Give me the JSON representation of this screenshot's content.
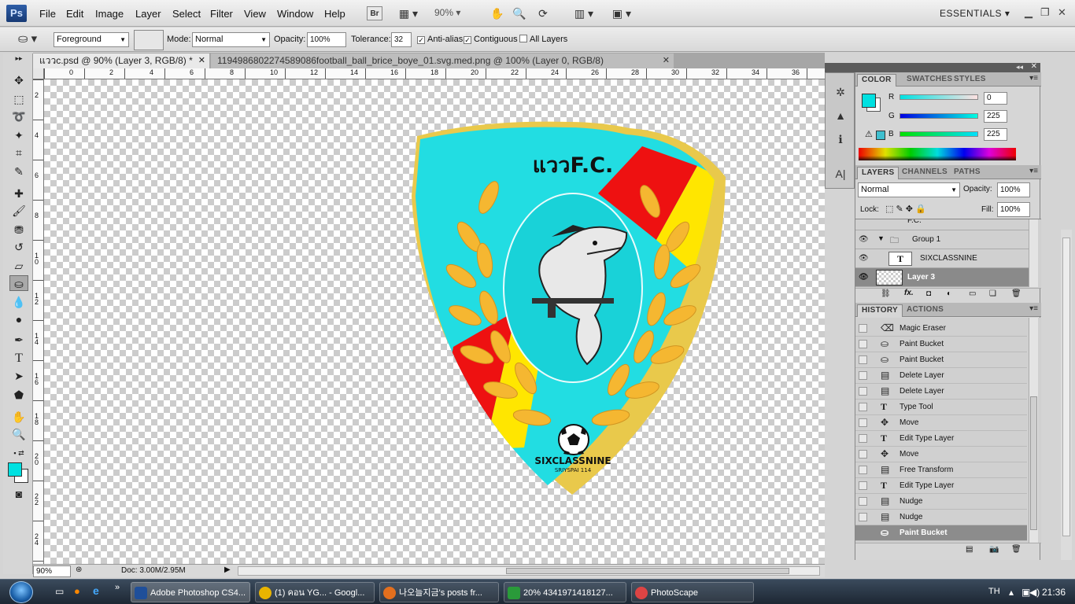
{
  "menubar": {
    "logo": "Ps",
    "items": [
      "File",
      "Edit",
      "Image",
      "Layer",
      "Select",
      "Filter",
      "View",
      "Window",
      "Help"
    ],
    "br_label": "Br",
    "zoom": "90%",
    "workspace": "ESSENTIALS"
  },
  "options": {
    "fill_source": "Foreground",
    "mode_label": "Mode:",
    "mode_value": "Normal",
    "opacity_label": "Opacity:",
    "opacity_value": "100%",
    "tolerance_label": "Tolerance:",
    "tolerance_value": "32",
    "anti_alias": "Anti-alias",
    "contiguous": "Contiguous",
    "all_layers": "All Layers"
  },
  "tabs": [
    {
      "label": "แววc.psd @ 90% (Layer 3, RGB/8) *"
    },
    {
      "label": "1194986802274589086football_ball_brice_boye_01.svg.med.png @ 100% (Layer 0, RGB/8)"
    }
  ],
  "ruler": {
    "top": [
      "0",
      "2",
      "4",
      "6",
      "8",
      "10",
      "12",
      "14",
      "16",
      "18",
      "20",
      "22",
      "24",
      "26",
      "28",
      "30",
      "32",
      "34",
      "36"
    ],
    "left": [
      "2",
      "4",
      "6",
      "8",
      "1 0",
      "1 2",
      "1 4",
      "1 6",
      "1 8",
      "2 0",
      "2 2",
      "2 4"
    ]
  },
  "artwork": {
    "club_name": "แววF.C.",
    "team_name": "SIXCLASSNINE",
    "subtitle": "SRIYSPAI 114",
    "colors": {
      "shield": "#22dde2",
      "border": "#e9c94b",
      "red": "#ee1111",
      "yellow": "#ffe600",
      "leaves": "#f5b731"
    }
  },
  "status": {
    "zoom": "90%",
    "doc": "Doc: 3.00M/2.95M"
  },
  "color_panel": {
    "tabs": [
      "COLOR",
      "SWATCHES",
      "STYLES"
    ],
    "r_label": "R",
    "g_label": "G",
    "b_label": "B",
    "r": "0",
    "g": "225",
    "b": "225",
    "fg": "#00e1e1"
  },
  "layers_panel": {
    "tabs": [
      "LAYERS",
      "CHANNELS",
      "PATHS"
    ],
    "blend": "Normal",
    "opacity_label": "Opacity:",
    "opacity": "100%",
    "lock_label": "Lock:",
    "fill_label": "Fill:",
    "fill": "100%",
    "layers": [
      {
        "name": "Group 1"
      },
      {
        "name": "SIXCLASSNINE"
      },
      {
        "name": "Layer 3"
      }
    ],
    "partial_top": "F.C."
  },
  "history_panel": {
    "tabs": [
      "HISTORY",
      "ACTIONS"
    ],
    "items": [
      {
        "name": "Magic Eraser",
        "icon": "eraser-icon"
      },
      {
        "name": "Paint Bucket",
        "icon": "bucket-icon"
      },
      {
        "name": "Paint Bucket",
        "icon": "bucket-icon"
      },
      {
        "name": "Delete Layer",
        "icon": "layer-icon"
      },
      {
        "name": "Delete Layer",
        "icon": "layer-icon"
      },
      {
        "name": "Type Tool",
        "icon": "type-icon"
      },
      {
        "name": "Move",
        "icon": "move-icon"
      },
      {
        "name": "Edit Type Layer",
        "icon": "type-icon"
      },
      {
        "name": "Move",
        "icon": "move-icon"
      },
      {
        "name": "Free Transform",
        "icon": "layer-icon"
      },
      {
        "name": "Edit Type Layer",
        "icon": "type-icon"
      },
      {
        "name": "Nudge",
        "icon": "layer-icon"
      },
      {
        "name": "Nudge",
        "icon": "layer-icon"
      },
      {
        "name": "Paint Bucket",
        "icon": "bucket-icon"
      }
    ]
  },
  "taskbar": {
    "tasks": [
      {
        "label": "Adobe Photoshop CS4...",
        "color": "#1f4f9a"
      },
      {
        "label": "(1) คอน YG... - Googl...",
        "color": "#e9b400"
      },
      {
        "label": "나오늘지금's posts fr...",
        "color": "#e36f1e"
      },
      {
        "label": "20% 4341971418127...",
        "color": "#2a9a3a"
      },
      {
        "label": "PhotoScape",
        "color": "#d44"
      }
    ],
    "lang": "TH",
    "time": "21:36"
  }
}
